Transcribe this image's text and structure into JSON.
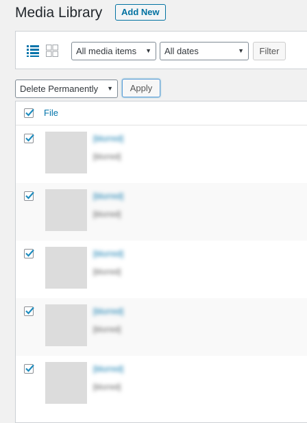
{
  "header": {
    "title": "Media Library",
    "add_new_label": "Add New"
  },
  "filters": {
    "media_type_selected": "All media items",
    "date_selected": "All dates",
    "filter_button_label": "Filter"
  },
  "bulk": {
    "action_selected": "Delete Permanently",
    "apply_label": "Apply"
  },
  "table": {
    "column_file_label": "File",
    "rows": [
      {
        "title": "[blurred]",
        "filename": "[blurred]"
      },
      {
        "title": "[blurred]",
        "filename": "[blurred]"
      },
      {
        "title": "[blurred]",
        "filename": "[blurred]"
      },
      {
        "title": "[blurred]",
        "filename": "[blurred]"
      },
      {
        "title": "[blurred]",
        "filename": "[blurred]"
      }
    ]
  },
  "colors": {
    "accent": "#0073aa",
    "checkbox_check": "#1e8cbe"
  },
  "icons": [
    "list-view-icon",
    "grid-view-icon",
    "dropdown-caret-icon",
    "checkmark-icon"
  ]
}
